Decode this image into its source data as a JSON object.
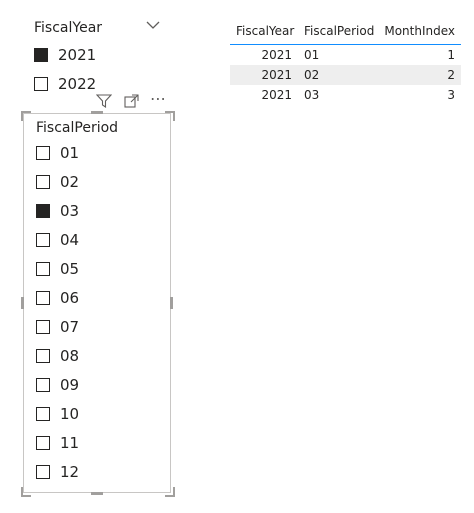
{
  "fiscal_year_slicer": {
    "title": "FiscalYear",
    "items": [
      {
        "label": "2021",
        "checked": true
      },
      {
        "label": "2022",
        "checked": false
      }
    ]
  },
  "fiscal_period_slicer": {
    "title": "FiscalPeriod",
    "items": [
      {
        "label": "01",
        "checked": false
      },
      {
        "label": "02",
        "checked": false
      },
      {
        "label": "03",
        "checked": true
      },
      {
        "label": "04",
        "checked": false
      },
      {
        "label": "05",
        "checked": false
      },
      {
        "label": "06",
        "checked": false
      },
      {
        "label": "07",
        "checked": false
      },
      {
        "label": "08",
        "checked": false
      },
      {
        "label": "09",
        "checked": false
      },
      {
        "label": "10",
        "checked": false
      },
      {
        "label": "11",
        "checked": false
      },
      {
        "label": "12",
        "checked": false
      }
    ]
  },
  "visual_toolbar": {
    "icons": [
      "filter-icon",
      "focus-mode-icon",
      "more-options-icon"
    ],
    "more_glyph": "⋯"
  },
  "table": {
    "columns": [
      "FiscalYear",
      "FiscalPeriod",
      "MonthIndex"
    ],
    "rows": [
      [
        "2021",
        "01",
        "1"
      ],
      [
        "2021",
        "02",
        "2"
      ],
      [
        "2021",
        "03",
        "3"
      ]
    ]
  },
  "colors": {
    "accent": "#118dff",
    "text": "#252423",
    "border": "#c8c6c4",
    "row_alt": "#eeeeee"
  }
}
